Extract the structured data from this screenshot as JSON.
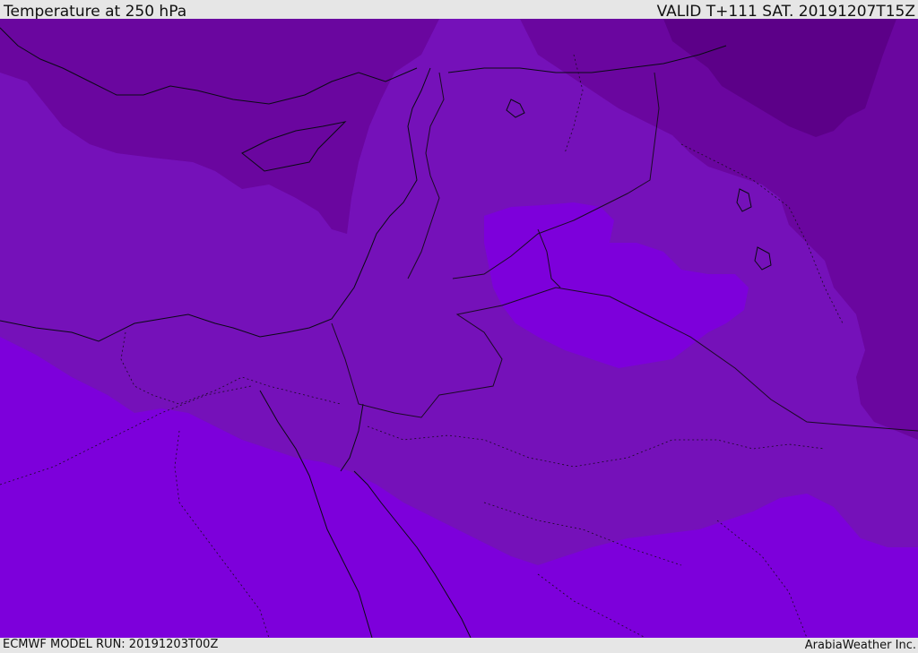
{
  "header": {
    "title": "Temperature at 250 hPa",
    "valid": "VALID T+111 SAT. 20191207T15Z"
  },
  "footer": {
    "model_run": "ECMWF MODEL RUN: 20191203T00Z",
    "credit": "ArabiaWeather Inc."
  },
  "colors": {
    "band_warmest": "#7d00db",
    "band_warm": "#7511b9",
    "band_mid": "#6a069f",
    "band_cold": "#5c0088",
    "coastline": "#0a0a14",
    "background": "#e6e6e6"
  },
  "layers": [
    "temperature-fill",
    "coastlines",
    "country-borders",
    "admin-borders"
  ]
}
